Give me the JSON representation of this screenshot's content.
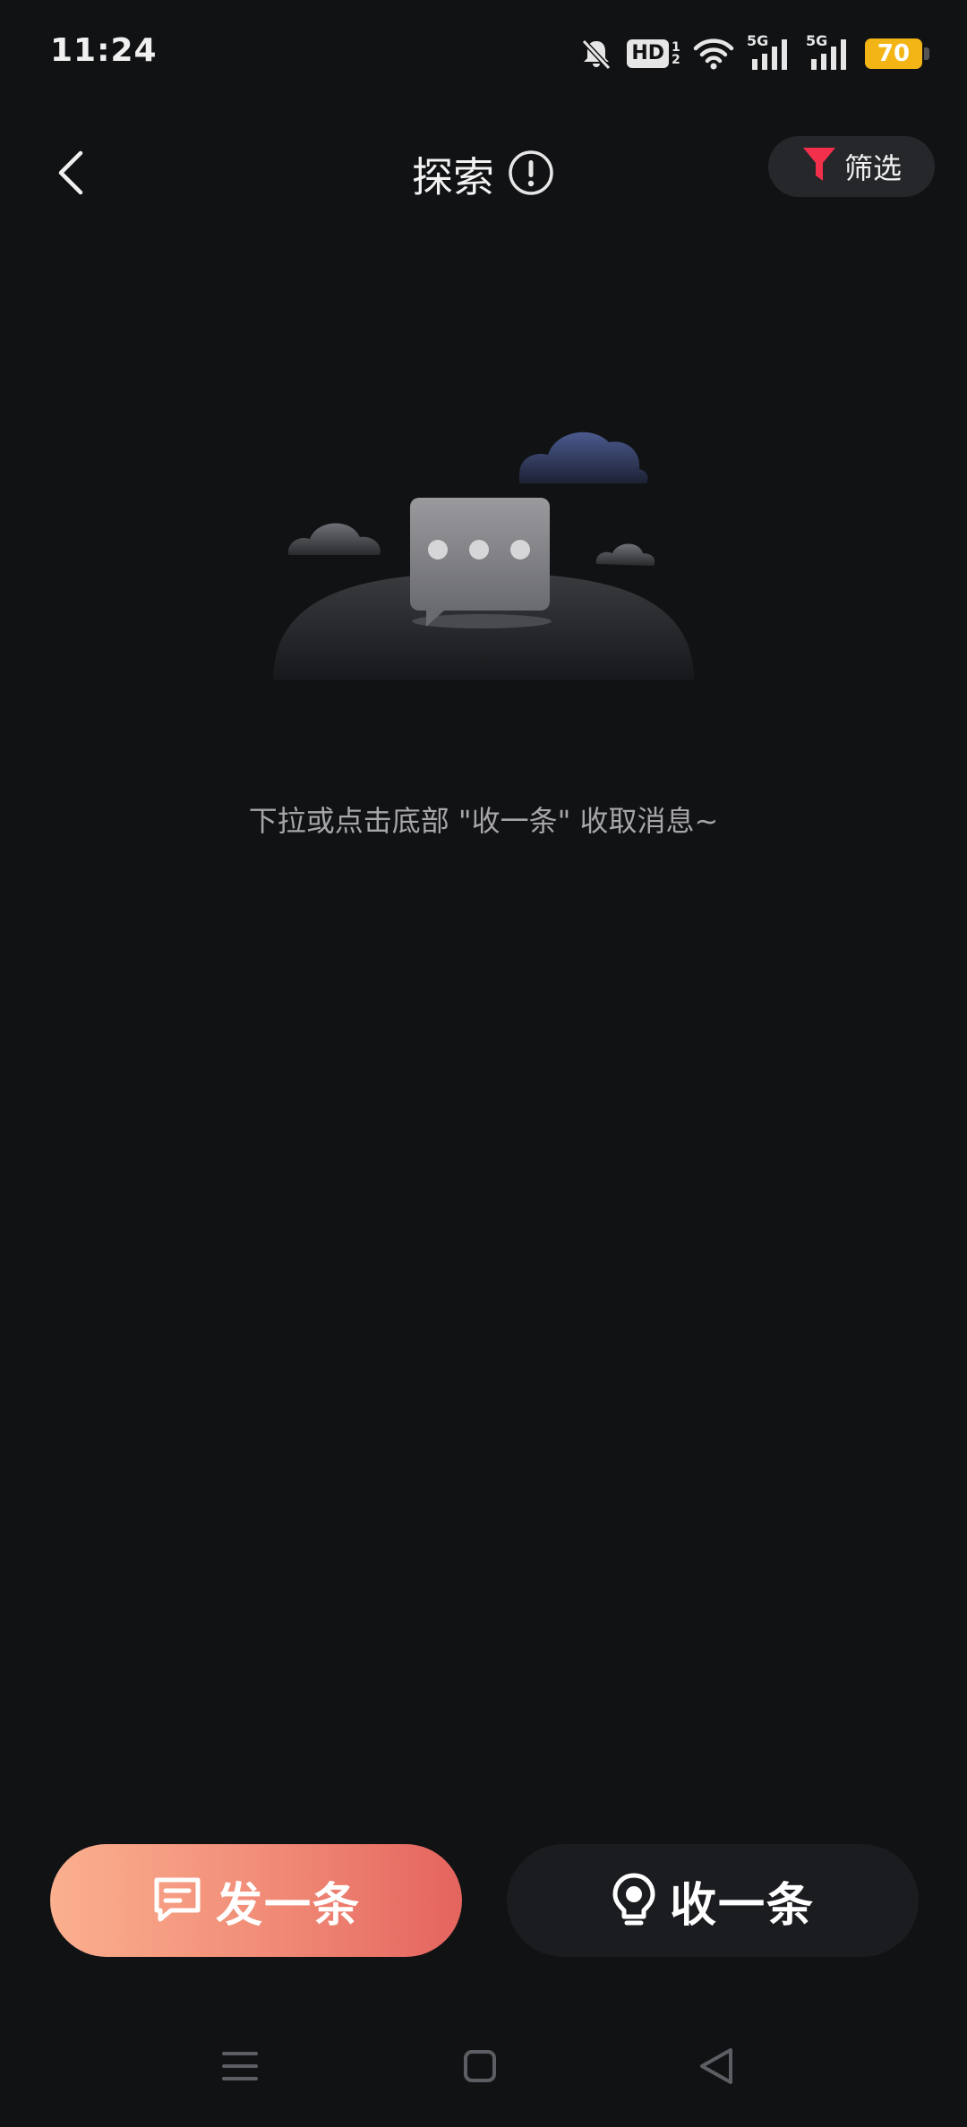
{
  "status_bar": {
    "time": "11:24",
    "network_1": "5G",
    "network_2": "5G",
    "hd_label": "HD",
    "hd_sub": "1 2",
    "battery_level": "70",
    "battery_color": "#f3b515"
  },
  "header": {
    "title": "探索",
    "filter_label": "筛选",
    "filter_icon_color": "#f2304b"
  },
  "empty_state": {
    "hint": "下拉或点击底部 \"收一条\" 收取消息~"
  },
  "actions": {
    "send_label": "发一条",
    "receive_label": "收一条",
    "send_gradient": [
      "#fbb08f",
      "#e4645e"
    ]
  },
  "icons": {
    "back": "chevron-left-icon",
    "info": "exclamation-circle-icon",
    "filter": "funnel-icon",
    "send": "message-square-icon",
    "receive": "lightbulb-icon",
    "nav_menu": "menu-icon",
    "nav_home": "square-icon",
    "nav_back": "triangle-back-icon"
  }
}
